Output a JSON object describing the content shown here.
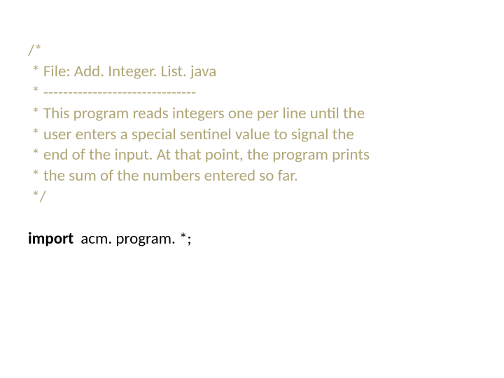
{
  "comment": {
    "l1": "/*",
    "l2": " * File: Add. Integer. List. java",
    "l3": " * -------------------------------",
    "l4": " * This program reads integers one per line until the",
    "l5": " * user enters a special sentinel value to signal the",
    "l6": " * end of the input. At that point, the program prints",
    "l7": " * the sum of the numbers entered so far.",
    "l8": " */"
  },
  "import_stmt": {
    "keyword": "import",
    "rest": "acm. program. *;"
  }
}
